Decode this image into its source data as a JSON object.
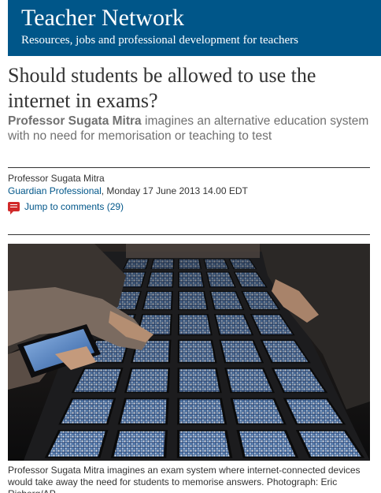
{
  "banner": {
    "title": "Teacher Network",
    "subtitle": "Resources, jobs and professional development for teachers",
    "color": "#005689"
  },
  "article": {
    "headline": "Should students be allowed to use the internet in exams?",
    "standfirst_author": "Professor Sugata Mitra",
    "standfirst_rest": " imagines an alternative education system with no need for memorisation or teaching to test",
    "byline": "Professor Sugata Mitra",
    "source": "Guardian Professional",
    "date": ", Monday 17 June 2013 14.00 EDT",
    "comments_label": "Jump to comments (29)",
    "comment_icon": "comment-bubble-icon",
    "link_color": "#005689"
  },
  "photo": {
    "caption": "Professor Sugata Mitra imagines an exam system where internet-connected devices would take away the need for students to memorise answers. Photograph: Eric Risberg/AP"
  }
}
